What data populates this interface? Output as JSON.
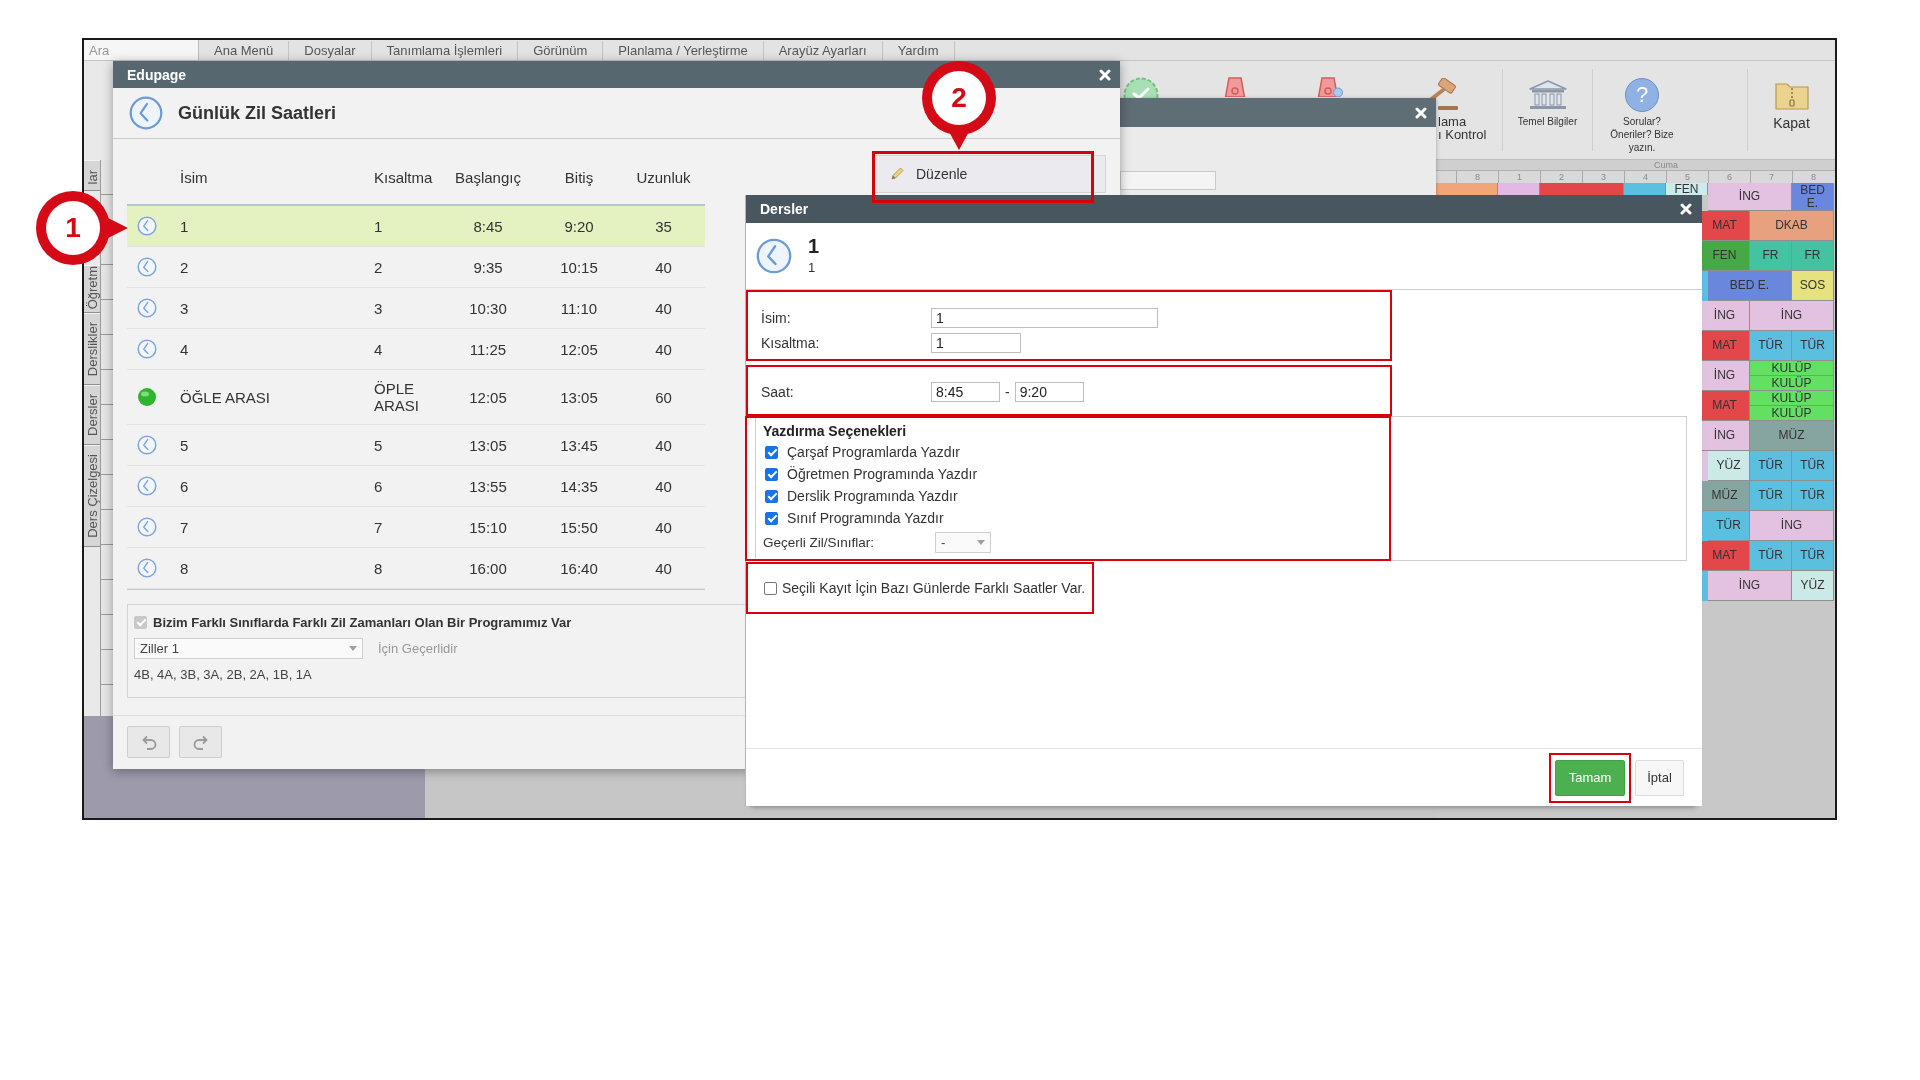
{
  "menu_bar": {
    "search": {
      "placeholder": "Ara"
    },
    "items": [
      "Ana Menü",
      "Dosyalar",
      "Tanımlama İşlemleri",
      "Görünüm",
      "Planlama / Yerleştirme",
      "Arayüz Ayarları",
      "Yardım"
    ]
  },
  "ribbon": {
    "items": [
      {
        "kind": "check"
      },
      {
        "kind": "lamp"
      },
      {
        "kind": "lamp_badge"
      },
      {
        "kind": "gavel",
        "lines": [
          "lama",
          "ı Kontrol"
        ]
      },
      {
        "kind": "bank",
        "lines": [
          "Temel Bilgiler"
        ]
      },
      {
        "kind": "help",
        "glyph": "?",
        "lines": [
          "Sorular?",
          "Öneriler? Bize",
          "yazın."
        ]
      },
      {
        "kind": "archive",
        "lines": [
          "Kapat"
        ]
      }
    ]
  },
  "side_tabs": [
    "lar",
    "Öğretm",
    "Derslikler",
    "Dersler",
    "Ders Çizelgesi"
  ],
  "timetable": {
    "day": "Cuma",
    "period_numbers": [
      "8",
      "1",
      "2",
      "3",
      "4",
      "5",
      "6",
      "7",
      "8"
    ],
    "lesson_rows": [
      {
        "blocks": [
          {
            "kind": "double",
            "color": "#f2a678"
          },
          {
            "kind": "single",
            "color": "#e2b9e2"
          },
          {
            "kind": "double",
            "color": "#e2474a"
          },
          {
            "kind": "single",
            "color": "#5bbfe0"
          },
          {
            "kind": "single",
            "color": "#c9ecec",
            "labels": [
              "FEN"
            ]
          },
          {
            "kind": "double",
            "color": "#e2c2e0",
            "labels": [
              "İNG"
            ]
          },
          {
            "kind": "single",
            "color": "#6987dd",
            "labels": [
              "BED E."
            ]
          }
        ]
      },
      {
        "blocks": [
          {
            "kind": "double",
            "color": "#e2474a",
            "labels": [
              "MAT"
            ]
          },
          {
            "kind": "double",
            "color": "#e8a17f",
            "labels": [
              "DKAB"
            ]
          }
        ]
      },
      {
        "blocks": [
          {
            "kind": "double",
            "color": "#46a846",
            "labels": [
              "FEN"
            ]
          },
          {
            "kind": "single",
            "color": "#43c3a1",
            "labels": [
              "FR"
            ]
          },
          {
            "kind": "single",
            "color": "#43c3a1",
            "labels": [
              "FR"
            ]
          }
        ]
      },
      {
        "blocks": [
          {
            "kind": "single",
            "color": "#5bbfe0"
          },
          {
            "kind": "double",
            "color": "#6987dd",
            "labels": [
              "BED E."
            ]
          },
          {
            "kind": "single",
            "color": "#e6e27e",
            "labels": [
              "SOS"
            ]
          }
        ]
      },
      {
        "blocks": [
          {
            "kind": "double",
            "color": "#e2c2e0",
            "labels": [
              "İNG"
            ]
          },
          {
            "kind": "double",
            "color": "#e2c2e0",
            "labels": [
              "İNG"
            ]
          }
        ]
      },
      {
        "blocks": [
          {
            "kind": "double",
            "color": "#e2474a",
            "labels": [
              "MAT"
            ]
          },
          {
            "kind": "single",
            "color": "#5bbfe0",
            "labels": [
              "TÜR"
            ]
          },
          {
            "kind": "single",
            "color": "#5bbfe0",
            "labels": [
              "TÜR"
            ]
          }
        ]
      },
      {
        "blocks": [
          {
            "kind": "double",
            "color": "#e2c2e0",
            "labels": [
              "İNG"
            ]
          },
          {
            "kind": "double",
            "color": "#62e062",
            "labels": [
              "KULÜP",
              "KULÜP"
            ]
          }
        ]
      },
      {
        "blocks": [
          {
            "kind": "double",
            "color": "#e2474a",
            "labels": [
              "MAT"
            ]
          },
          {
            "kind": "double",
            "color": "#62e062",
            "labels": [
              "KULÜP",
              "KULÜP"
            ]
          }
        ]
      },
      {
        "blocks": [
          {
            "kind": "double",
            "color": "#e2c2e0",
            "labels": [
              "İNG"
            ]
          },
          {
            "kind": "double",
            "color": "#86a5a0",
            "labels": [
              "MÜZ"
            ]
          }
        ]
      },
      {
        "blocks": [
          {
            "kind": "single",
            "color": "#e2c2e0"
          },
          {
            "kind": "single",
            "color": "#cbe9e6",
            "labels": [
              "YÜZ"
            ]
          },
          {
            "kind": "single",
            "color": "#5bbfe0",
            "labels": [
              "TÜR"
            ]
          },
          {
            "kind": "single",
            "color": "#5bbfe0",
            "labels": [
              "TÜR"
            ]
          }
        ]
      },
      {
        "blocks": [
          {
            "kind": "double",
            "color": "#86a5a0",
            "labels": [
              "MÜZ"
            ]
          },
          {
            "kind": "single",
            "color": "#5bbfe0",
            "labels": [
              "TÜR"
            ]
          },
          {
            "kind": "single",
            "color": "#5bbfe0",
            "labels": [
              "TÜR"
            ]
          }
        ]
      },
      {
        "blocks": [
          {
            "kind": "single",
            "color": "#5bbfe0"
          },
          {
            "kind": "single",
            "color": "#5bbfe0",
            "labels": [
              "TÜR"
            ]
          },
          {
            "kind": "double",
            "color": "#e2c2e0",
            "labels": [
              "İNG"
            ]
          }
        ]
      },
      {
        "blocks": [
          {
            "kind": "double",
            "color": "#e2474a",
            "labels": [
              "MAT"
            ]
          },
          {
            "kind": "single",
            "color": "#5bbfe0",
            "labels": [
              "TÜR"
            ]
          },
          {
            "kind": "single",
            "color": "#5bbfe0",
            "labels": [
              "TÜR"
            ]
          }
        ]
      },
      {
        "blocks": [
          {
            "kind": "single",
            "color": "#5bbfe0"
          },
          {
            "kind": "double",
            "color": "#e2c2e0",
            "labels": [
              "İNG"
            ]
          },
          {
            "kind": "single",
            "color": "#cbe9e6",
            "labels": [
              "YÜZ"
            ]
          }
        ]
      }
    ]
  },
  "bell_window": {
    "title": "Edupage",
    "heading": "Günlük Zil Saatleri",
    "columns": [
      "İsim",
      "Kısaltma",
      "Başlangıç",
      "Bitiş",
      "Uzunluk"
    ],
    "rows": [
      {
        "kind": "lesson",
        "name": "1",
        "short": "1",
        "start": "8:45",
        "end": "9:20",
        "length": "35",
        "selected": true
      },
      {
        "kind": "lesson",
        "name": "2",
        "short": "2",
        "start": "9:35",
        "end": "10:15",
        "length": "40",
        "selected": false
      },
      {
        "kind": "lesson",
        "name": "3",
        "short": "3",
        "start": "10:30",
        "end": "11:10",
        "length": "40",
        "selected": false
      },
      {
        "kind": "lesson",
        "name": "4",
        "short": "4",
        "start": "11:25",
        "end": "12:05",
        "length": "40",
        "selected": false
      },
      {
        "kind": "break",
        "name": "ÖĞLE ARASI",
        "short": "ÖPLE ARASI",
        "start": "12:05",
        "end": "13:05",
        "length": "60",
        "selected": false
      },
      {
        "kind": "lesson",
        "name": "5",
        "short": "5",
        "start": "13:05",
        "end": "13:45",
        "length": "40",
        "selected": false
      },
      {
        "kind": "lesson",
        "name": "6",
        "short": "6",
        "start": "13:55",
        "end": "14:35",
        "length": "40",
        "selected": false
      },
      {
        "kind": "lesson",
        "name": "7",
        "short": "7",
        "start": "15:10",
        "end": "15:50",
        "length": "40",
        "selected": false
      },
      {
        "kind": "lesson",
        "name": "8",
        "short": "8",
        "start": "16:00",
        "end": "16:40",
        "length": "40",
        "selected": false
      }
    ],
    "edit_button": {
      "label": "Düzenle",
      "highlighted": true
    },
    "multi_bells": {
      "checked": true,
      "disabled": true,
      "label": "Bizim Farklı Sınıflarda Farklı Zil Zamanları Olan Bir Programımız Var",
      "select": "Ziller 1",
      "note": "İçin Geçerlidir",
      "classes": "4B, 4A, 3B, 3A, 2B, 2A, 1B, 1A"
    },
    "toolbar": [
      {
        "kind": "undo",
        "disabled": true
      },
      {
        "kind": "redo",
        "disabled": true
      }
    ]
  },
  "lesson_window": {
    "title": "Dersler",
    "heading": "1",
    "subheading": "1",
    "name_group": {
      "highlighted": true,
      "fields": [
        {
          "label": "İsim:",
          "value": "1"
        },
        {
          "label": "Kısaltma:",
          "value": "1"
        }
      ]
    },
    "time_group": {
      "highlighted": true,
      "label": "Saat:",
      "start": "8:45",
      "separator": "-",
      "end": "9:20"
    },
    "print_group": {
      "highlighted": true,
      "title": "Yazdırma Seçenekleri",
      "options": [
        {
          "label": "Çarşaf Programlarda Yazdır",
          "checked": true
        },
        {
          "label": "Öğretmen Programında Yazdır",
          "checked": true
        },
        {
          "label": "Derslik Programında Yazdır",
          "checked": true
        },
        {
          "label": "Sınıf Programında Yazdır",
          "checked": true
        }
      ],
      "scope_label": "Geçerli Zil/Sınıflar:",
      "scope_value": "-"
    },
    "different_days": {
      "highlighted": true,
      "label": "Seçili Kayıt İçin Bazı Günlerde Farklı Saatler Var.",
      "checked": false
    },
    "buttons": [
      {
        "kind": "primary",
        "label": "Tamam",
        "highlighted": true
      },
      {
        "kind": "secondary",
        "label": "İptal",
        "highlighted": false
      }
    ]
  },
  "callouts": [
    {
      "number": "1"
    },
    {
      "number": "2"
    }
  ]
}
